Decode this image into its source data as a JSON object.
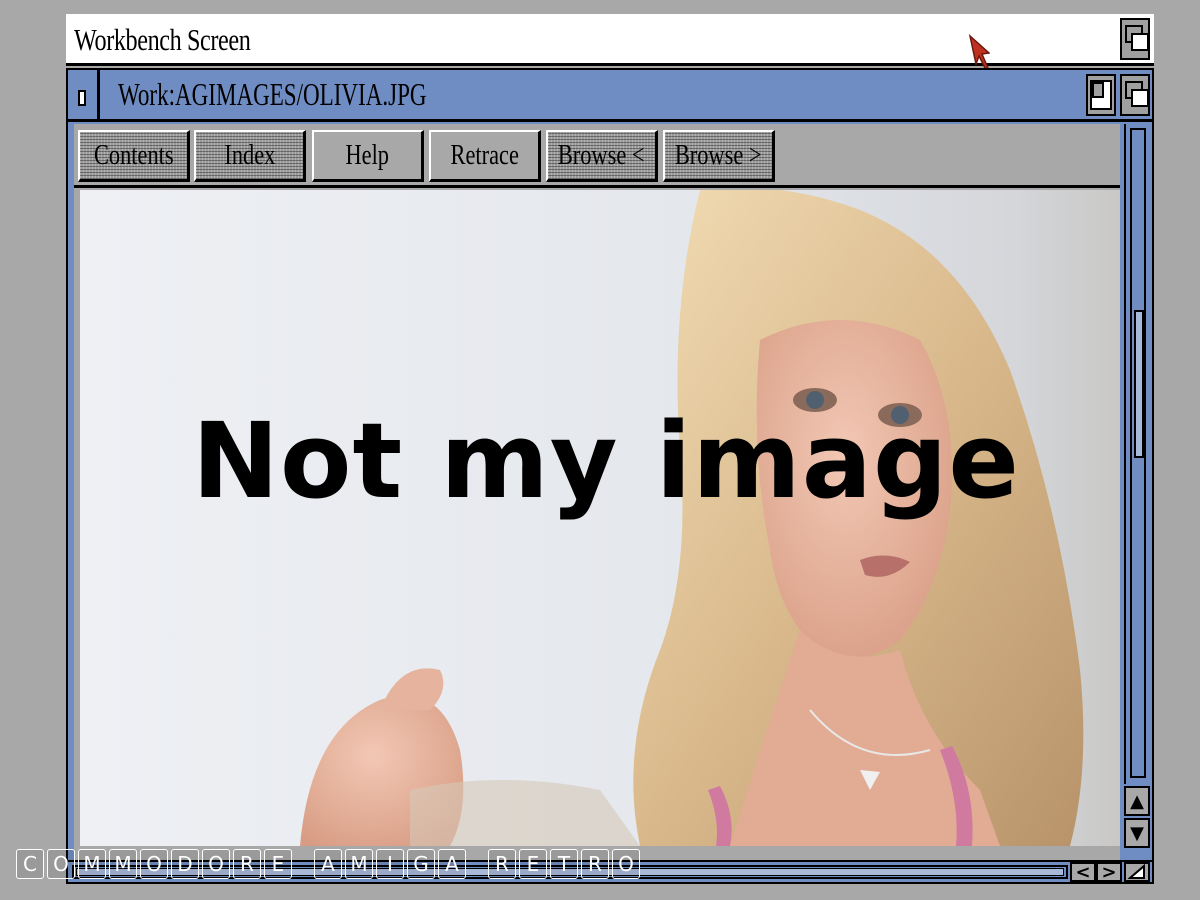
{
  "screen": {
    "title": "Workbench Screen"
  },
  "window": {
    "title": "Work:AGIMAGES/OLIVIA.JPG"
  },
  "toolbar": {
    "buttons": [
      {
        "label": "Contents",
        "enabled": false
      },
      {
        "label": "Index",
        "enabled": false
      },
      {
        "label": "Help",
        "enabled": true
      },
      {
        "label": "Retrace",
        "enabled": true
      },
      {
        "label": "Browse <",
        "enabled": false
      },
      {
        "label": "Browse >",
        "enabled": false
      }
    ]
  },
  "image": {
    "overlay_text": "Not my image",
    "subject": "photo-portrait-woman-blonde"
  },
  "scrollbars": {
    "vertical": {
      "up_icon": "▲",
      "down_icon": "▼"
    },
    "horizontal": {
      "left_icon": "<",
      "right_icon": ">"
    }
  },
  "brand": {
    "letters": [
      "C",
      "O",
      "M",
      "M",
      "O",
      "D",
      "O",
      "R",
      "E",
      " ",
      "A",
      "M",
      "I",
      "G",
      "A",
      " ",
      "R",
      "E",
      "T",
      "R",
      "O"
    ]
  },
  "colors": {
    "window_blue": "#6f8dc2",
    "chrome_gray": "#a8a8a8",
    "pointer_red": "#c03020"
  }
}
